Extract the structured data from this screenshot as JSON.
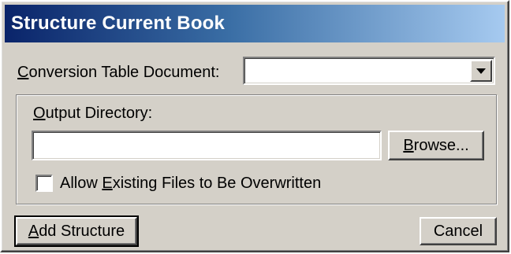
{
  "dialog": {
    "title": "Structure Current Book"
  },
  "conversion_table": {
    "label_prefix": "C",
    "label_rest": "onversion Table Document:",
    "value": ""
  },
  "output_directory": {
    "label_prefix": "O",
    "label_rest": "utput Directory:",
    "value": "",
    "browse_prefix": "B",
    "browse_rest": "rowse..."
  },
  "overwrite": {
    "label_before": "Allow ",
    "label_mnemonic": "E",
    "label_after": "xisting Files to Be Overwritten",
    "checked": false
  },
  "buttons": {
    "add_prefix": "A",
    "add_rest": "dd Structure",
    "cancel": "Cancel"
  },
  "icons": {
    "dropdown": "chevron-down-icon"
  }
}
